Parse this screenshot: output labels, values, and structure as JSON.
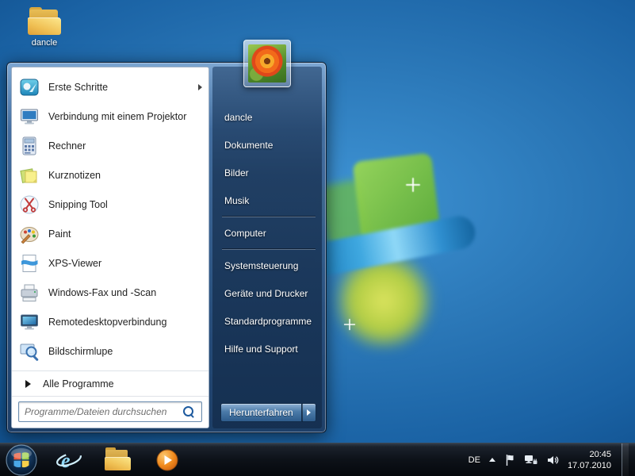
{
  "desktop": {
    "folder_label": "dancle",
    "colors": {
      "background_blue": "#2b78b8",
      "logo_green": "#7dc242",
      "logo_blue": "#3fa8e0",
      "logo_yellow": "#c6d64a"
    }
  },
  "start_menu": {
    "left_items": [
      {
        "label": "Erste Schritte",
        "icon": "getting-started-icon",
        "has_submenu": true
      },
      {
        "label": "Verbindung mit einem Projektor",
        "icon": "projector-icon",
        "has_submenu": false
      },
      {
        "label": "Rechner",
        "icon": "calculator-icon",
        "has_submenu": false
      },
      {
        "label": "Kurznotizen",
        "icon": "sticky-notes-icon",
        "has_submenu": false
      },
      {
        "label": "Snipping Tool",
        "icon": "snipping-tool-icon",
        "has_submenu": false
      },
      {
        "label": "Paint",
        "icon": "paint-icon",
        "has_submenu": false
      },
      {
        "label": "XPS-Viewer",
        "icon": "xps-viewer-icon",
        "has_submenu": false
      },
      {
        "label": "Windows-Fax und -Scan",
        "icon": "fax-scan-icon",
        "has_submenu": false
      },
      {
        "label": "Remotedesktopverbindung",
        "icon": "remote-desktop-icon",
        "has_submenu": false
      },
      {
        "label": "Bildschirmlupe",
        "icon": "screen-magnifier-icon",
        "has_submenu": false
      }
    ],
    "all_programs_label": "Alle Programme",
    "search": {
      "placeholder": "Programme/Dateien durchsuchen",
      "icon": "search-icon"
    },
    "user": {
      "name": "dancle",
      "avatar": "flower-avatar"
    },
    "right_items": [
      "dancle",
      "Dokumente",
      "Bilder",
      "Musik",
      "Computer",
      "Systemsteuerung",
      "Geräte und Drucker",
      "Standardprogramme",
      "Hilfe und Support"
    ],
    "shutdown": {
      "label": "Herunterfahren",
      "arrow_icon": "shutdown-options-arrow"
    }
  },
  "taskbar": {
    "start_orb_icon": "windows-start-orb",
    "pinned_icons": [
      "internet-explorer-icon",
      "windows-explorer-folder-icon",
      "media-player-icon"
    ],
    "tray": {
      "language_indicator": "DE",
      "icons": [
        "show-hidden-icons-chevron",
        "action-center-flag-icon",
        "network-icon",
        "volume-icon"
      ],
      "time": "20:45",
      "date": "17.07.2010"
    }
  }
}
